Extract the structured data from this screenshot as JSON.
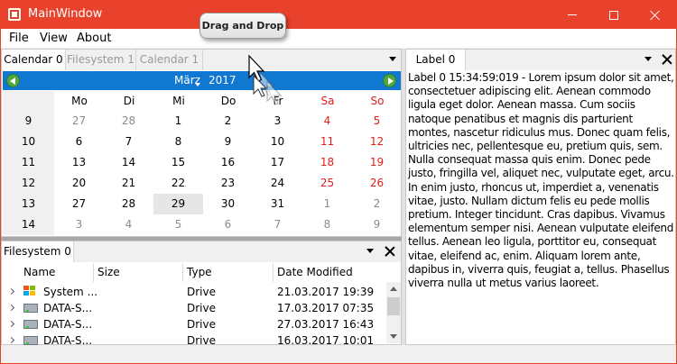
{
  "window": {
    "title": "MainWindow"
  },
  "menu": [
    "File",
    "View",
    "About"
  ],
  "tooltip": "Drag and Drop",
  "calendar_tabs": [
    "Calendar 0",
    "Filesystem 1",
    "Calendar 1"
  ],
  "calendar": {
    "month": "März",
    "year": "2017",
    "weekdays": [
      "Mo",
      "Di",
      "Mi",
      "Do",
      "Fr",
      "Sa",
      "So"
    ],
    "weeks": [
      {
        "num": "9",
        "days": [
          "27",
          "28",
          "1",
          "2",
          "3",
          "4",
          "5"
        ]
      },
      {
        "num": "10",
        "days": [
          "6",
          "7",
          "8",
          "9",
          "10",
          "11",
          "12"
        ]
      },
      {
        "num": "11",
        "days": [
          "13",
          "14",
          "15",
          "16",
          "17",
          "18",
          "19"
        ]
      },
      {
        "num": "12",
        "days": [
          "20",
          "21",
          "22",
          "23",
          "24",
          "25",
          "26"
        ]
      },
      {
        "num": "13",
        "days": [
          "27",
          "28",
          "29",
          "30",
          "31",
          "1",
          "2"
        ]
      },
      {
        "num": "14",
        "days": [
          "3",
          "4",
          "5",
          "6",
          "7",
          "8",
          "9"
        ]
      }
    ],
    "selected_day": "29",
    "weekend_color": "#e31c1c",
    "accent": "#1178d2"
  },
  "filesystem": {
    "tab": "Filesystem 0",
    "columns": [
      "Name",
      "Size",
      "Type",
      "Date Modified"
    ],
    "rows": [
      {
        "name": "System ...",
        "size": "",
        "type": "Drive",
        "date": "21.03.2017 19:39",
        "icon": "system-drive-icon"
      },
      {
        "name": "DATA-S...",
        "size": "",
        "type": "Drive",
        "date": "17.03.2017 07:35",
        "icon": "drive-icon"
      },
      {
        "name": "DATA-S...",
        "size": "",
        "type": "Drive",
        "date": "27.03.2017 16:43",
        "icon": "drive-icon"
      },
      {
        "name": "DATA-S...",
        "size": "",
        "type": "Drive",
        "date": "16.03.2017 10:01",
        "icon": "drive-icon"
      }
    ]
  },
  "label_panel": {
    "tab": "Label 0",
    "text": "Label 0 15:34:59:019 - Lorem ipsum dolor sit amet, consectetuer adipiscing elit. Aenean commodo ligula eget dolor. Aenean massa. Cum sociis natoque penatibus et magnis dis parturient montes, nascetur ridiculus mus. Donec quam felis, ultricies nec, pellentesque eu, pretium quis, sem. Nulla consequat massa quis enim. Donec pede justo, fringilla vel, aliquet nec, vulputate eget, arcu. In enim justo, rhoncus ut, imperdiet a, venenatis vitae, justo. Nullam dictum felis eu pede mollis pretium. Integer tincidunt. Cras dapibus. Vivamus elementum semper nisi. Aenean vulputate eleifend tellus. Aenean leo ligula, porttitor eu, consequat vitae, eleifend ac, enim. Aliquam lorem ante, dapibus in, viverra quis, feugiat a, tellus. Phasellus viverra nulla ut metus varius laoreet."
  }
}
